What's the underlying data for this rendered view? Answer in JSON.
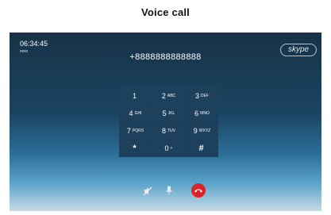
{
  "caption": "Voice call",
  "status": {
    "time": "06:34:45",
    "subtext": "xxxx"
  },
  "logo": {
    "text": "skype"
  },
  "call": {
    "number": "+8888888888888"
  },
  "keypad": {
    "keys": [
      {
        "digit": "1",
        "letters": ""
      },
      {
        "digit": "2",
        "letters": "ABC"
      },
      {
        "digit": "3",
        "letters": "DEF"
      },
      {
        "digit": "4",
        "letters": "GHI"
      },
      {
        "digit": "5",
        "letters": "JKL"
      },
      {
        "digit": "6",
        "letters": "MNO"
      },
      {
        "digit": "7",
        "letters": "PQRS"
      },
      {
        "digit": "8",
        "letters": "TUV"
      },
      {
        "digit": "9",
        "letters": "WXYZ"
      },
      {
        "digit": "*",
        "letters": ""
      },
      {
        "digit": "0",
        "letters": "+"
      },
      {
        "digit": "#",
        "letters": ""
      }
    ]
  },
  "controls": {
    "mute_icon": "speaker-off-icon",
    "mic_icon": "microphone-icon",
    "hangup_icon": "phone-hangup-icon",
    "hangup_color": "#d9252a"
  }
}
